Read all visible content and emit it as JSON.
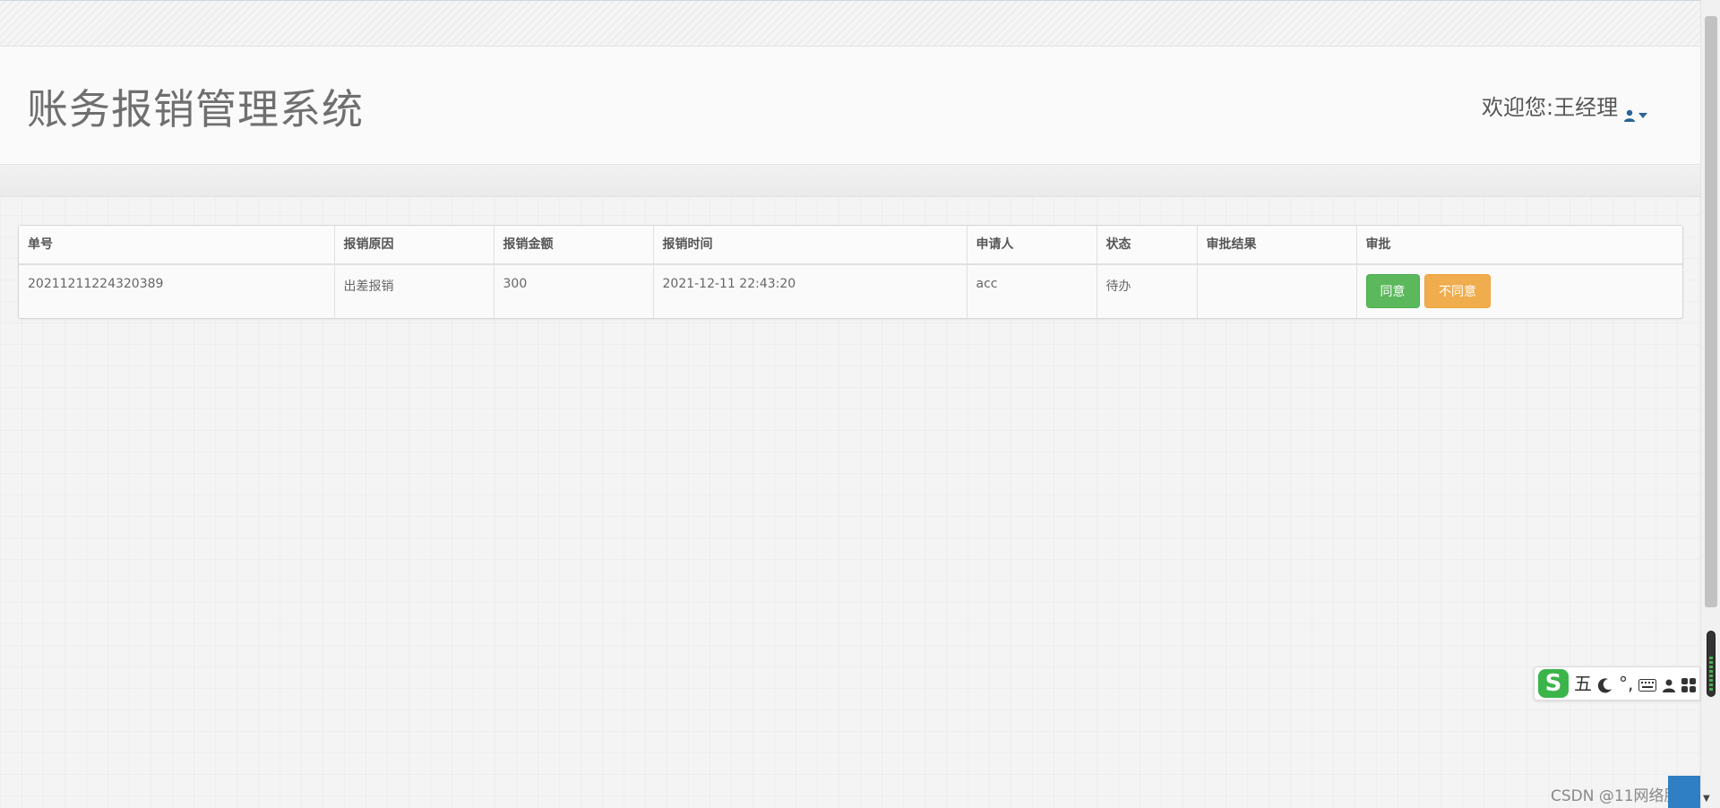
{
  "app_title": "账务报销管理系统",
  "welcome_text": "欢迎您:王经理",
  "table": {
    "headers": [
      "单号",
      "报销原因",
      "报销金额",
      "报销时间",
      "申请人",
      "状态",
      "审批结果",
      "审批"
    ],
    "rows": [
      {
        "id": "20211211224320389",
        "reason": "出差报销",
        "amount": "300",
        "time": "2021-12-11 22:43:20",
        "applicant": "acc",
        "status": "待办",
        "result": "",
        "approve_label": "同意",
        "reject_label": "不同意"
      }
    ]
  },
  "ime": {
    "logo": "S",
    "mode": "五",
    "punct": "°,",
    "icons": [
      "moon-icon",
      "keyboard-icon",
      "user-icon",
      "grid-icon"
    ]
  },
  "watermark": "CSDN @11网络服务",
  "colors": {
    "approve": "#5cb85c",
    "reject": "#f0ad4e",
    "user_icon": "#2a6496"
  }
}
